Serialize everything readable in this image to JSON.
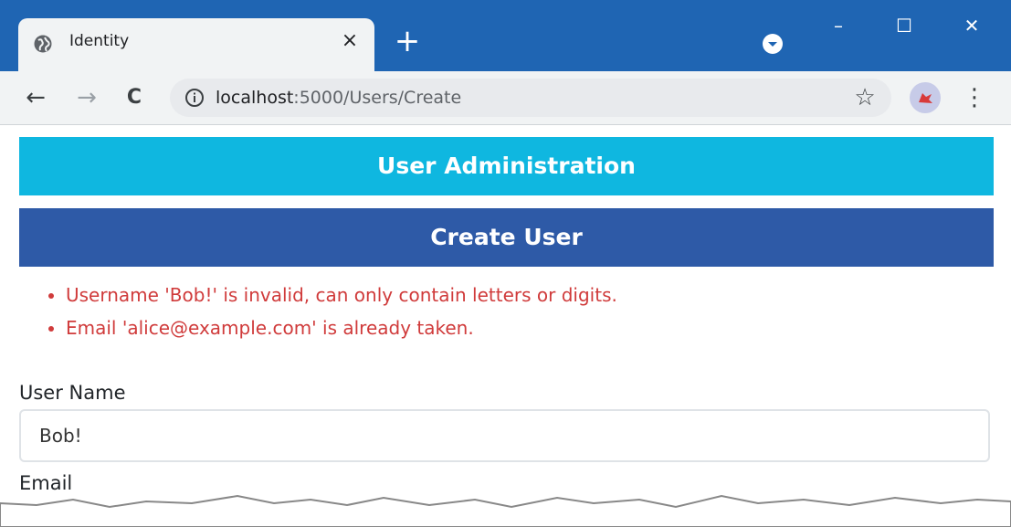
{
  "browser": {
    "tab_title": "Identity",
    "tab_close": "×",
    "new_tab": "+",
    "url_host": "localhost",
    "url_path": ":5000/Users/Create",
    "window_controls": {
      "minimize": "–",
      "maximize": "☐",
      "close": "✕"
    },
    "nav": {
      "back": "←",
      "forward": "→",
      "reload": "C"
    },
    "star": "☆",
    "menu": "⋮",
    "colors": {
      "frame": "#1f65b3",
      "toolbar": "#f1f3f4"
    }
  },
  "page": {
    "header_title": "User Administration",
    "section_title": "Create User",
    "errors": [
      "Username 'Bob!' is invalid, can only contain letters or digits.",
      "Email 'alice@example.com' is already taken."
    ],
    "form": {
      "username_label": "User Name",
      "username_value": "Bob!",
      "email_label": "Email"
    },
    "colors": {
      "header": "#0fb7e0",
      "section": "#2e5aa7",
      "error": "#d03b3b"
    }
  }
}
